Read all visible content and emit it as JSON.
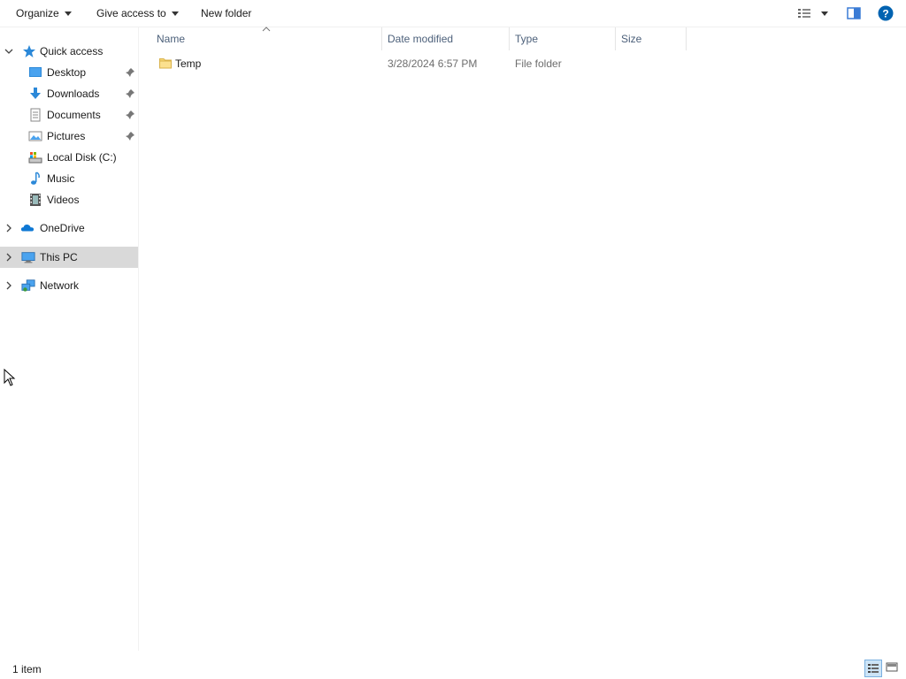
{
  "toolbar": {
    "organize_label": "Organize",
    "give_access_label": "Give access to",
    "new_folder_label": "New folder",
    "view_icon": "view-options-icon",
    "preview_pane_icon": "preview-pane-icon",
    "help_icon": "help-icon"
  },
  "nav": {
    "quick_access": "Quick access",
    "quick_items": [
      {
        "label": "Desktop",
        "icon": "desktop-icon",
        "pinned": true
      },
      {
        "label": "Downloads",
        "icon": "downloads-icon",
        "pinned": true
      },
      {
        "label": "Documents",
        "icon": "documents-icon",
        "pinned": true
      },
      {
        "label": "Pictures",
        "icon": "pictures-icon",
        "pinned": true
      },
      {
        "label": "Local Disk (C:)",
        "icon": "local-disk-icon",
        "pinned": false
      },
      {
        "label": "Music",
        "icon": "music-icon",
        "pinned": false
      },
      {
        "label": "Videos",
        "icon": "videos-icon",
        "pinned": false
      }
    ],
    "onedrive": "OneDrive",
    "this_pc": "This PC",
    "network": "Network",
    "selected": "This PC"
  },
  "columns": {
    "name": "Name",
    "date_modified": "Date modified",
    "type": "Type",
    "size": "Size"
  },
  "files": [
    {
      "name": "Temp",
      "date_modified": "3/28/2024 6:57 PM",
      "type": "File folder",
      "size": ""
    }
  ],
  "status": {
    "item_count": "1 item"
  },
  "colors": {
    "selected_row": "#d9d9d9",
    "header_text": "#4c607a",
    "accent": "#0063b1",
    "folder_yellow": "#f8d775"
  }
}
